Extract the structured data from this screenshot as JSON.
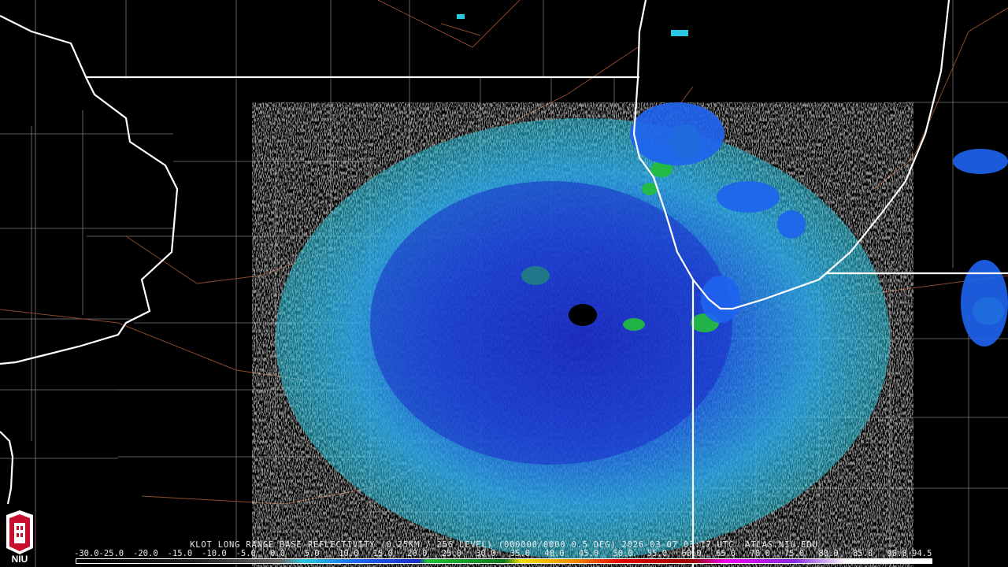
{
  "title": "KLOT LONG RANGE BASE REFLECTIVITY (0.25KM / 256 LEVEL) (000000/0000 0.5 DEG) 2026-03-07 03:17 UTC  ATLAS.NIU.EDU",
  "logo_text": "NIU",
  "scale_labels": [
    "-30.0",
    "-25.0",
    "-20.0",
    "-15.0",
    "-10.0",
    "-5.0",
    "0.0",
    "5.0",
    "10.0",
    "15.0",
    "20.0",
    "25.0",
    "30.0",
    "35.0",
    "40.0",
    "45.0",
    "50.0",
    "55.0",
    "60.0",
    "65.0",
    "70.0",
    "75.0",
    "80.0",
    "85.0",
    "90.0",
    "94.5"
  ],
  "colors": {
    "background": "#000000",
    "state_border": "#ffffff",
    "county_line": "#7a7a7a",
    "highway": "#8a4a2a",
    "light_blue": "#29c8e0",
    "blue": "#1e64f0",
    "dark_blue": "#1a2cc8",
    "green": "#22c03a",
    "niu_red": "#c8102e"
  }
}
